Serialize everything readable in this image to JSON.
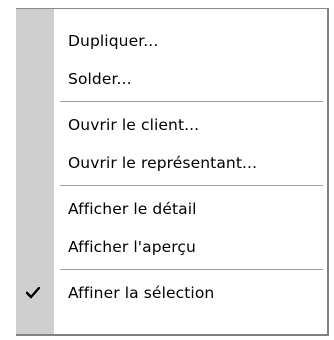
{
  "context_menu": {
    "groups": [
      {
        "items": [
          {
            "label": "Dupliquer...",
            "checked": false
          },
          {
            "label": "Solder...",
            "checked": false
          }
        ]
      },
      {
        "items": [
          {
            "label": "Ouvrir le client...",
            "checked": false
          },
          {
            "label": "Ouvrir le représentant...",
            "checked": false
          }
        ]
      },
      {
        "items": [
          {
            "label": "Afficher le détail",
            "checked": false
          },
          {
            "label": "Afficher l'aperçu",
            "checked": false
          }
        ]
      },
      {
        "items": [
          {
            "label": "Affiner la sélection",
            "checked": true,
            "icon": "check-icon"
          }
        ]
      }
    ],
    "colors": {
      "background": "#ffffff",
      "gutter": "#cfcfcf",
      "separator": "#a0a0a0",
      "text": "#000000"
    }
  }
}
